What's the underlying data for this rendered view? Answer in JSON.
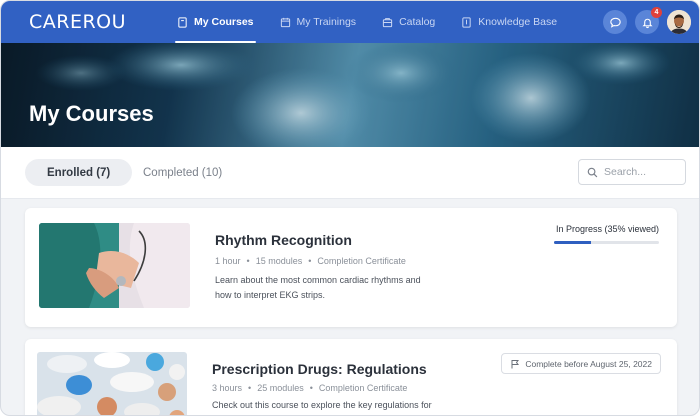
{
  "app": {
    "logo": "CAREROU"
  },
  "nav": {
    "items": [
      {
        "label": "My Courses",
        "icon": "book-icon",
        "active": true
      },
      {
        "label": "My Trainings",
        "icon": "calendar-icon",
        "active": false
      },
      {
        "label": "Catalog",
        "icon": "catalog-icon",
        "active": false
      },
      {
        "label": "Knowledge Base",
        "icon": "knowledge-base-icon",
        "active": false
      }
    ]
  },
  "header_actions": {
    "notification_count": "4"
  },
  "hero": {
    "title": "My Courses"
  },
  "tabs": {
    "enrolled": "Enrolled (7)",
    "completed": "Completed (10)"
  },
  "search": {
    "placeholder": "Search..."
  },
  "courses": [
    {
      "title": "Rhythm Recognition",
      "duration": "1 hour",
      "modules": "15 modules",
      "certificate": "Completion Certificate",
      "description": "Learn about the most common cardiac rhythms and how to interpret EKG strips.",
      "status": "In Progress (35% viewed)",
      "progress_fraction": 0.35
    },
    {
      "title": "Prescription Drugs: Regulations",
      "duration": "3 hours",
      "modules": "25 modules",
      "certificate": "Completion Certificate",
      "description": "Check out this course to explore the key regulations for",
      "deadline": "Complete before August 25, 2022"
    }
  ],
  "colors": {
    "brand": "#3161c3",
    "progress": "#2f5fc0",
    "badge": "#e0413a"
  }
}
